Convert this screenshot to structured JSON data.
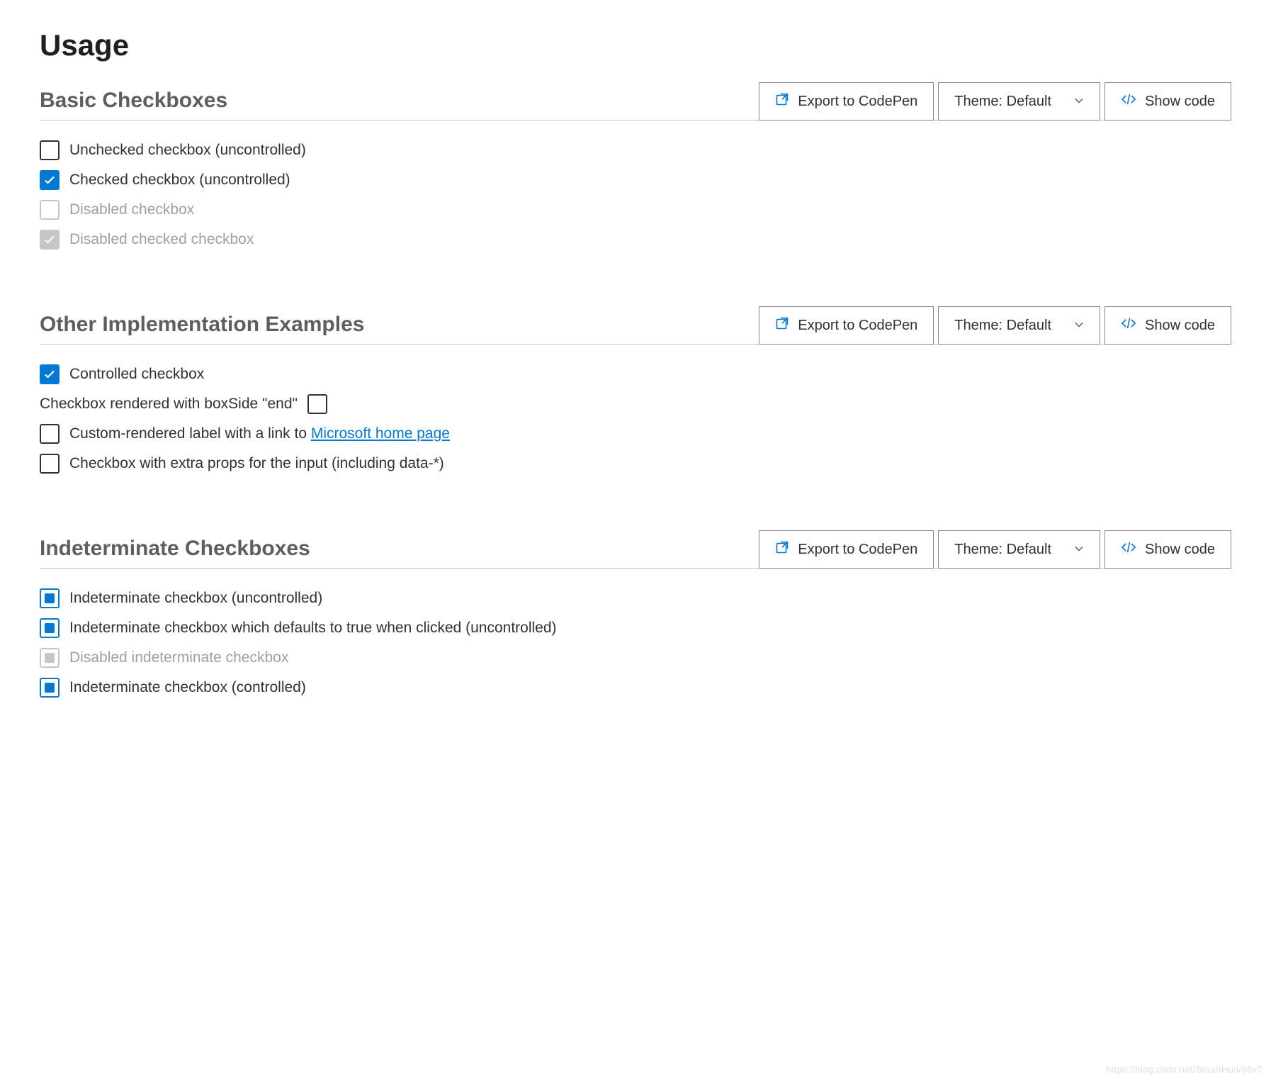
{
  "page": {
    "title": "Usage"
  },
  "toolbar": {
    "export_label": "Export to CodePen",
    "theme_label": "Theme: Default",
    "show_code_label": "Show code"
  },
  "sections": {
    "basic": {
      "title": "Basic Checkboxes",
      "items": [
        {
          "label": "Unchecked checkbox (uncontrolled)"
        },
        {
          "label": "Checked checkbox (uncontrolled)"
        },
        {
          "label": "Disabled checkbox"
        },
        {
          "label": "Disabled checked checkbox"
        }
      ]
    },
    "other": {
      "title": "Other Implementation Examples",
      "items": [
        {
          "label": "Controlled checkbox"
        },
        {
          "label": "Checkbox rendered with boxSide \"end\""
        },
        {
          "label_pre": "Custom-rendered label with a link to ",
          "link_text": "Microsoft home page"
        },
        {
          "label": "Checkbox with extra props for the input (including data-*)"
        }
      ]
    },
    "indet": {
      "title": "Indeterminate Checkboxes",
      "items": [
        {
          "label": "Indeterminate checkbox (uncontrolled)"
        },
        {
          "label": "Indeterminate checkbox which defaults to true when clicked (uncontrolled)"
        },
        {
          "label": "Disabled indeterminate checkbox"
        },
        {
          "label": "Indeterminate checkbox (controlled)"
        }
      ]
    }
  },
  "watermark": "https://blog.csdn.net/StuartHua/96x7"
}
